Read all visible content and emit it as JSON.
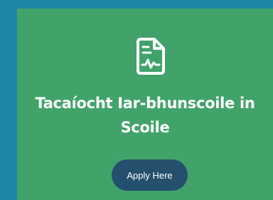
{
  "card": {
    "icon": "medical-report-document-icon",
    "title_line1": "Tacaíocht Iar-bhunscoile in",
    "title_line2": "Scoile",
    "apply_label": "Apply Here"
  },
  "colors": {
    "background": "#1d87a8",
    "card": "#41a36a",
    "button": "#24506e",
    "text": "#ffffff"
  }
}
